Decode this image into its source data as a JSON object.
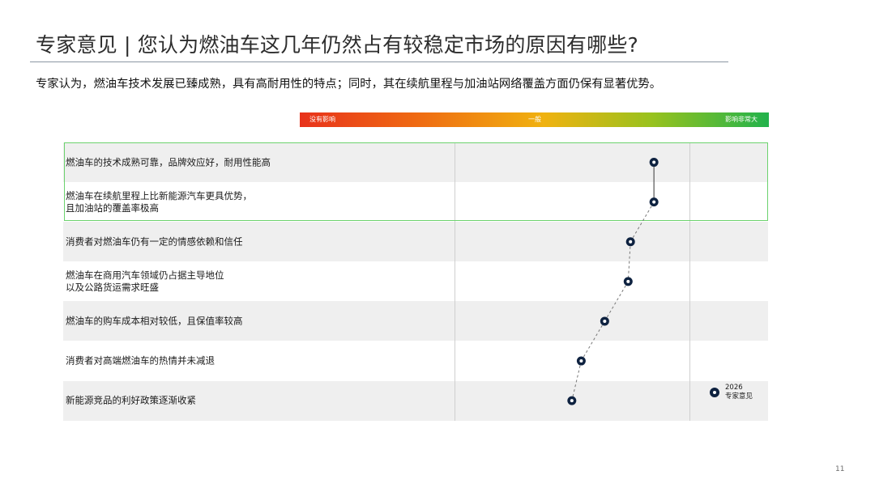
{
  "slide": {
    "title": "专家意见 | 您认为燃油车这几年仍然占有较稳定市场的原因有哪些?",
    "subtitle": "专家认为，燃油车技术发展已臻成熟，具有高耐用性的特点；同时，其在续航里程与加油站网络覆盖方面仍保有显著优势。",
    "page_number": "11"
  },
  "chart_data": {
    "type": "scatter",
    "scale": {
      "labels": [
        "没有影响",
        "一般",
        "影响非常大"
      ],
      "colors": [
        "#e8321b",
        "#f0b210",
        "#22b24c"
      ],
      "xlim": [
        1,
        5
      ]
    },
    "categories": [
      "燃油车的技术成熟可靠，品牌效应好，耐用性能高",
      "燃油车在续航里程上比新能源汽车更具优势，\n且加油站的覆盖率极高",
      "消费者对燃油车仍有一定的情感依赖和信任",
      "燃油车在商用汽车领域仍占据主导地位\n以及公路货运需求旺盛",
      "燃油车的购车成本相对较低，且保值率较高",
      "消费者对高端燃油车的热情并未减退",
      "新能源竞品的利好政策逐渐收紧"
    ],
    "series": [
      {
        "name": "2026\n专家意见",
        "values": [
          4.02,
          4.02,
          3.82,
          3.8,
          3.6,
          3.4,
          3.32
        ],
        "color": "#0e2240"
      }
    ],
    "highlighted_rows": [
      0,
      1
    ]
  }
}
